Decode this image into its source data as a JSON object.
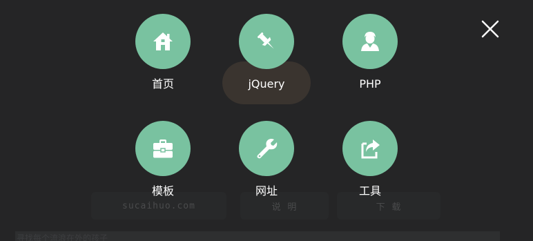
{
  "menu": {
    "items": [
      {
        "label": "首页",
        "icon": "home-icon"
      },
      {
        "label": "jQuery",
        "icon": "pin-icon"
      },
      {
        "label": "PHP",
        "icon": "user-icon"
      },
      {
        "label": "模板",
        "icon": "briefcase-icon"
      },
      {
        "label": "网址",
        "icon": "wrench-icon"
      },
      {
        "label": "工具",
        "icon": "share-icon"
      }
    ],
    "close_icon": "close-icon",
    "accent_color": "#79c2a0"
  },
  "background": {
    "buttons": [
      "sucaihuo.com",
      "说 明",
      "下 载"
    ],
    "bar_text": "寻找每个流浪在外的孩子"
  }
}
